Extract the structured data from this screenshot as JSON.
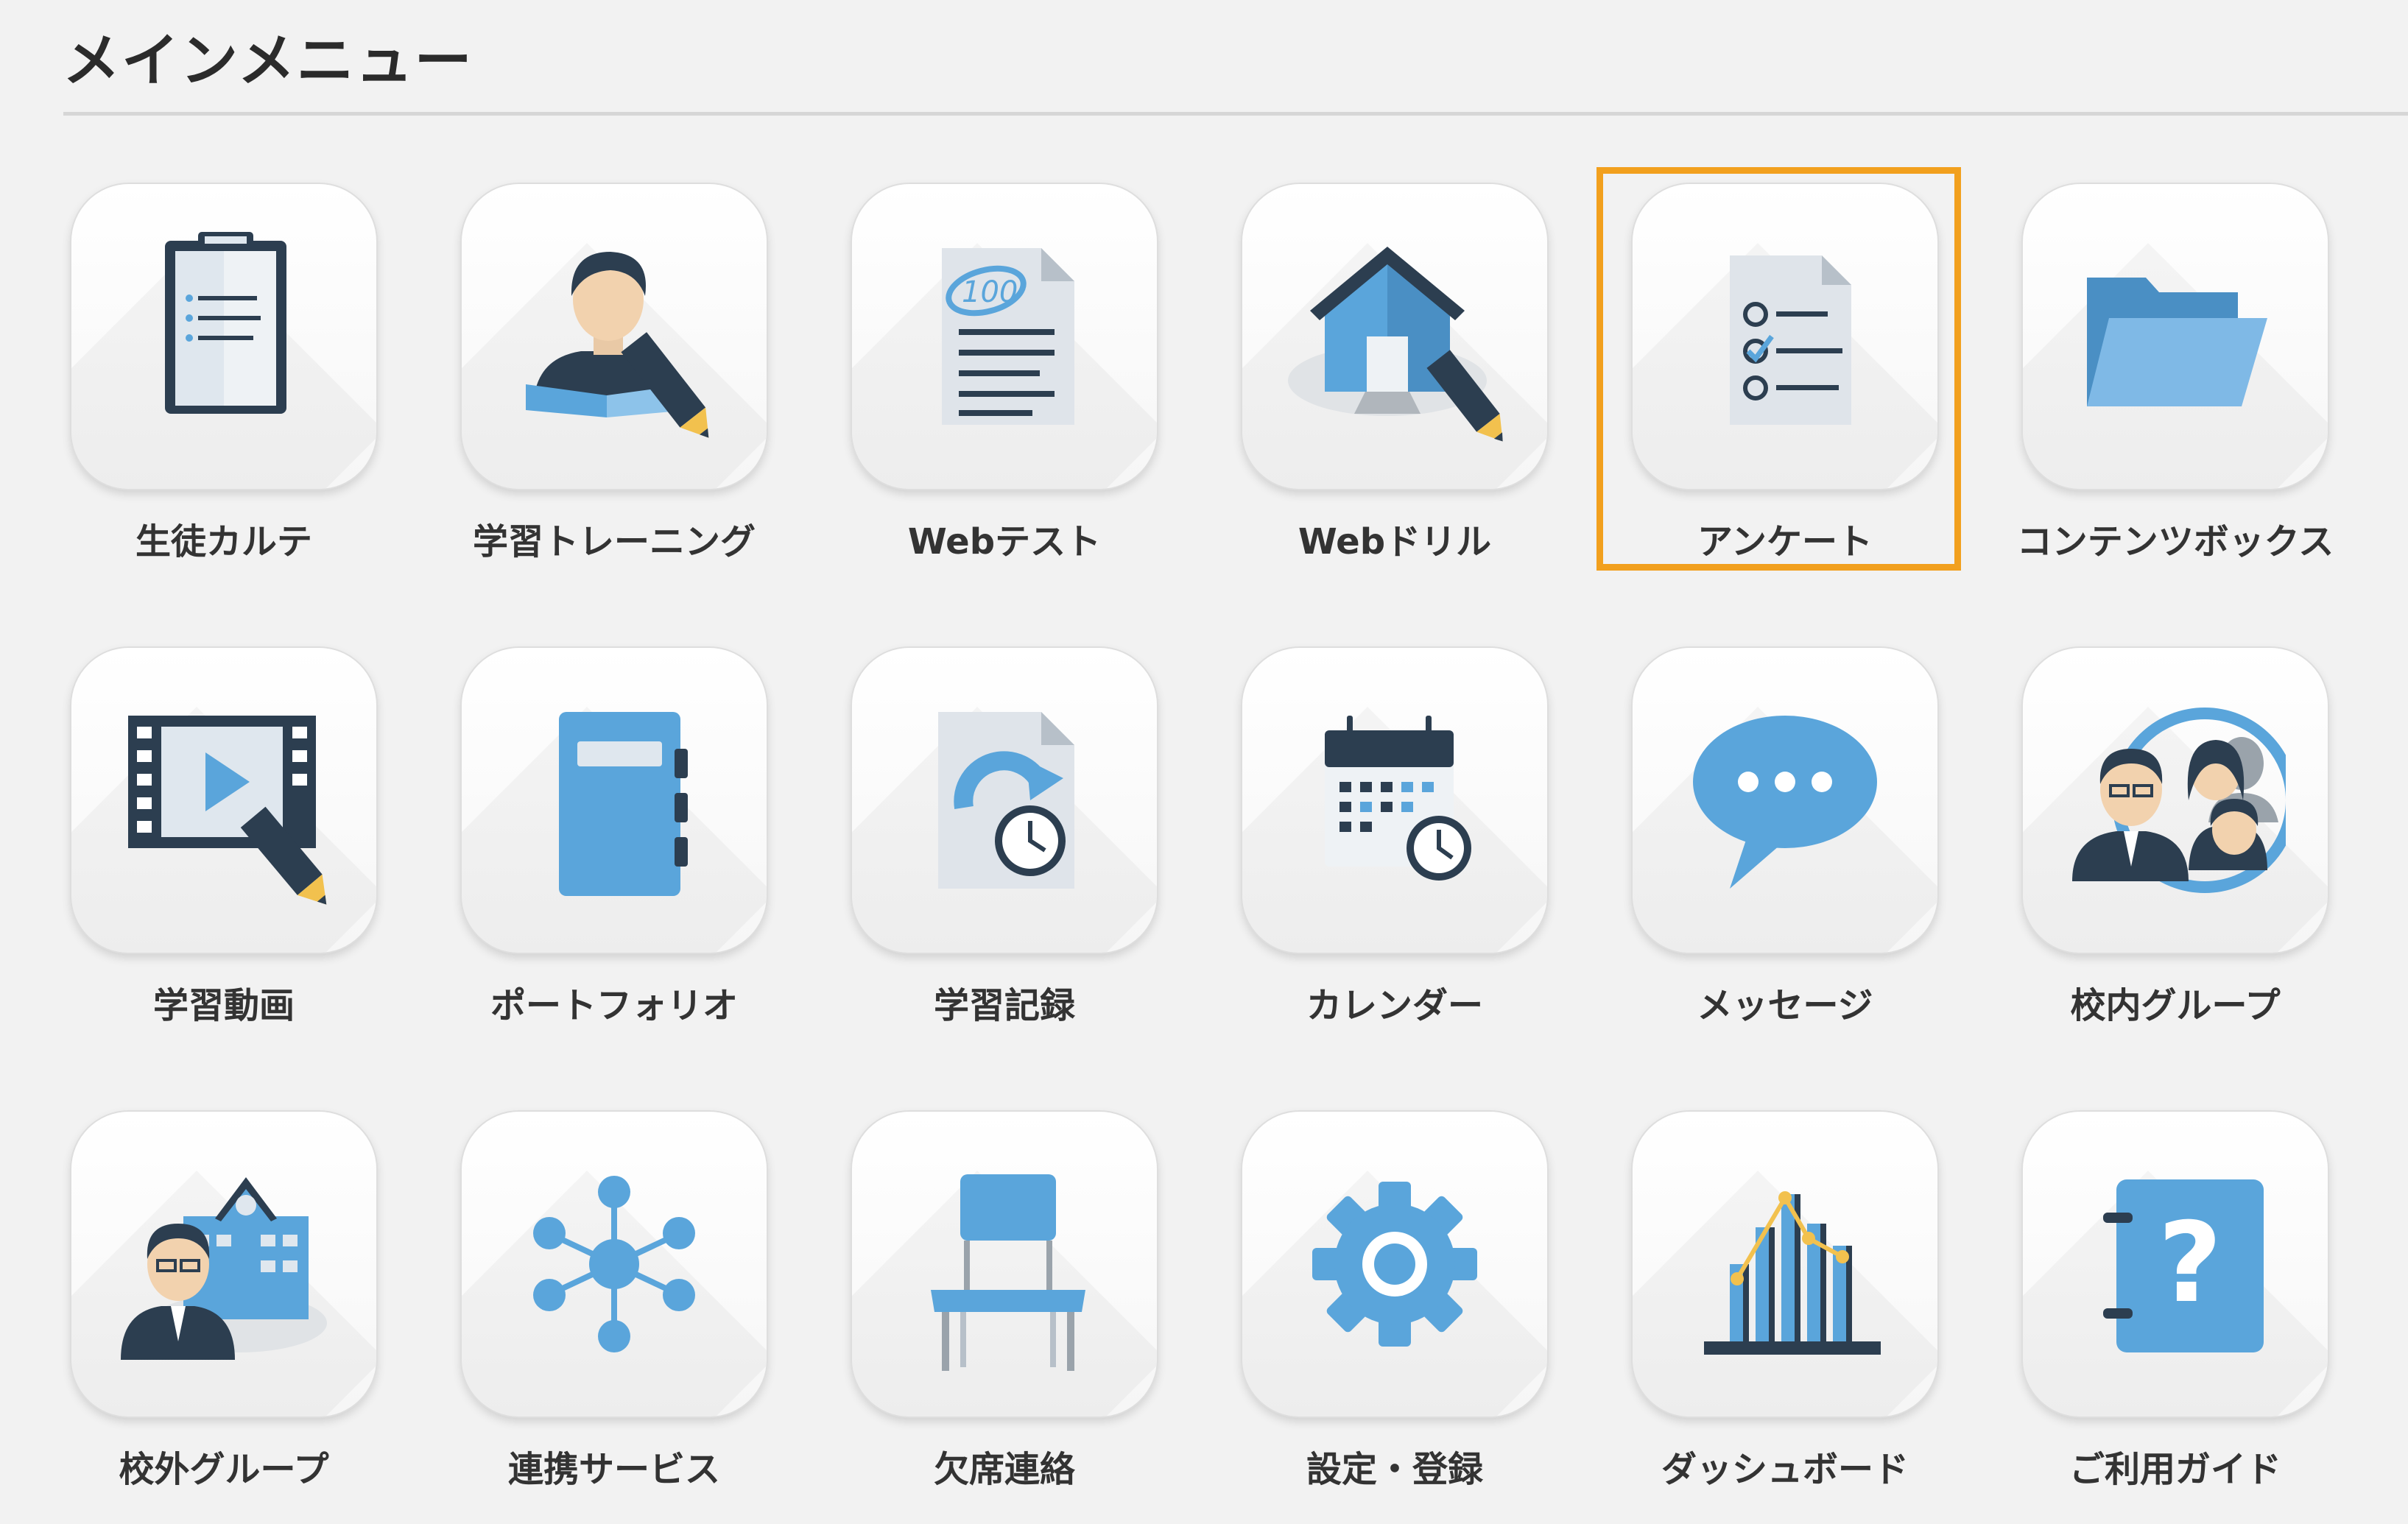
{
  "page": {
    "title": "メインメニュー"
  },
  "colors": {
    "accent": "#f2a01e",
    "icon_blue": "#5aa5db",
    "icon_navy": "#2c3e50"
  },
  "menu": {
    "selected": "アンケート",
    "items": [
      {
        "label": "生徒カルテ",
        "icon": "clipboard-icon"
      },
      {
        "label": "学習トレーニング",
        "icon": "student-reading-icon"
      },
      {
        "label": "Webテスト",
        "icon": "test-sheet-icon"
      },
      {
        "label": "Webドリル",
        "icon": "home-drill-icon"
      },
      {
        "label": "アンケート",
        "icon": "survey-checklist-icon"
      },
      {
        "label": "コンテンツボックス",
        "icon": "folder-icon"
      },
      {
        "label": "学習動画",
        "icon": "video-film-icon"
      },
      {
        "label": "ポートフォリオ",
        "icon": "notebook-icon"
      },
      {
        "label": "学習記録",
        "icon": "history-document-icon"
      },
      {
        "label": "カレンダー",
        "icon": "calendar-icon"
      },
      {
        "label": "メッセージ",
        "icon": "chat-bubble-icon"
      },
      {
        "label": "校内グループ",
        "icon": "group-people-icon"
      },
      {
        "label": "校外グループ",
        "icon": "school-building-icon"
      },
      {
        "label": "連携サービス",
        "icon": "network-icon"
      },
      {
        "label": "欠席連絡",
        "icon": "chair-icon"
      },
      {
        "label": "設定・登録",
        "icon": "gear-icon"
      },
      {
        "label": "ダッシュボード",
        "icon": "dashboard-chart-icon"
      },
      {
        "label": "ご利用ガイド",
        "icon": "help-book-icon"
      }
    ]
  }
}
